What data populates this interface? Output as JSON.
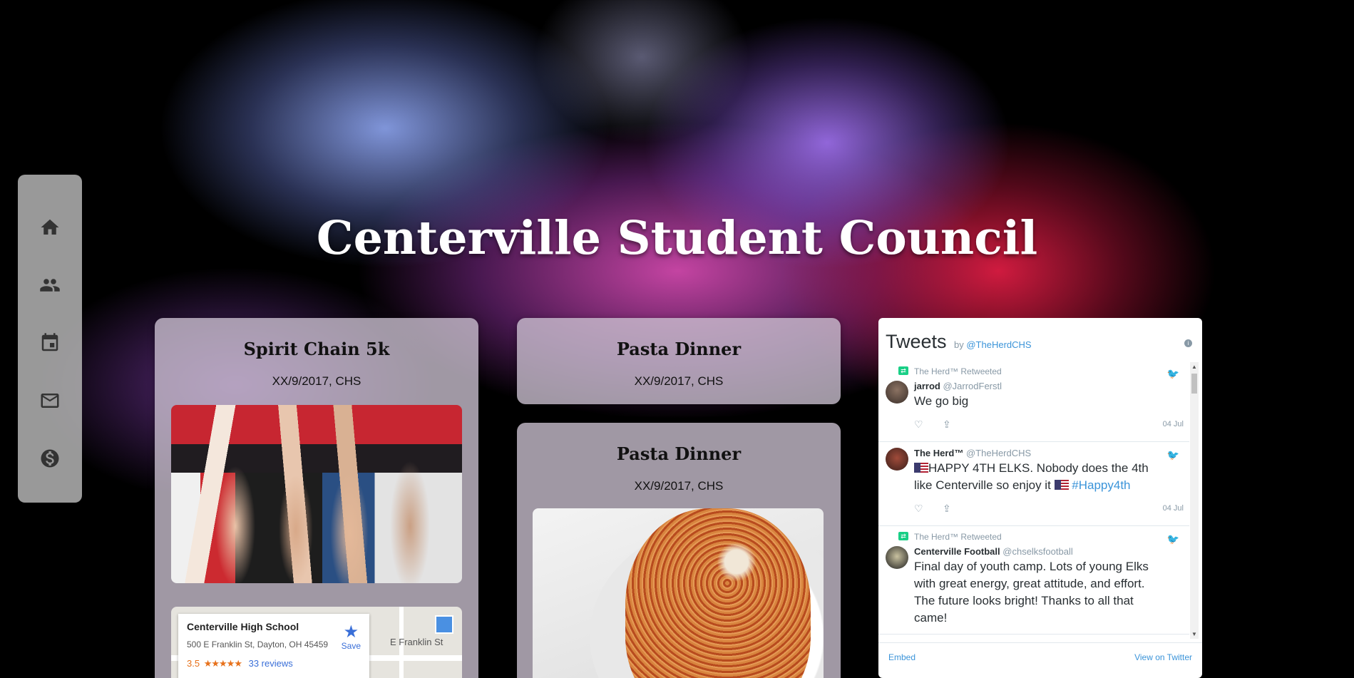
{
  "page": {
    "title": "Centerville Student Council"
  },
  "sidebar": {
    "items": [
      {
        "icon": "home-icon"
      },
      {
        "icon": "people-icon"
      },
      {
        "icon": "calendar-icon"
      },
      {
        "icon": "mail-icon"
      },
      {
        "icon": "dollar-icon"
      }
    ]
  },
  "cards": [
    {
      "title": "Spirit Chain 5k",
      "subtitle": "XX/9/2017, CHS"
    },
    {
      "title": "Pasta Dinner",
      "subtitle": "XX/9/2017, CHS"
    },
    {
      "title": "Pasta Dinner",
      "subtitle": "XX/9/2017, CHS"
    }
  ],
  "map": {
    "place": "Centerville High School",
    "address": "500 E Franklin St, Dayton, OH 45459",
    "rating": "3.5",
    "stars": "★★★★★",
    "reviews": "33 reviews",
    "save": "Save",
    "street": "E Franklin St"
  },
  "tweets": {
    "header": "Tweets",
    "by": "by",
    "handle": "@TheHerdCHS",
    "items": [
      {
        "retweet": "The Herd™ Retweeted",
        "name": "jarrod",
        "handle": "@JarrodFerstl",
        "text": "We go big",
        "date": "04 Jul"
      },
      {
        "retweet": "",
        "name": "The Herd™",
        "handle": "@TheHerdCHS",
        "text_a": "HAPPY 4TH ELKS. Nobody does the 4th like Centerville so enjoy it",
        "hashtag": "#Happy4th",
        "date": "04 Jul"
      },
      {
        "retweet": "The Herd™ Retweeted",
        "name": "Centerville Football",
        "handle": "@chselksfootball",
        "text": "Final day of youth camp. Lots of young Elks with great energy, great attitude, and effort. The future looks bright! Thanks to all that came!",
        "date": ""
      }
    ],
    "embed": "Embed",
    "view": "View on Twitter"
  }
}
